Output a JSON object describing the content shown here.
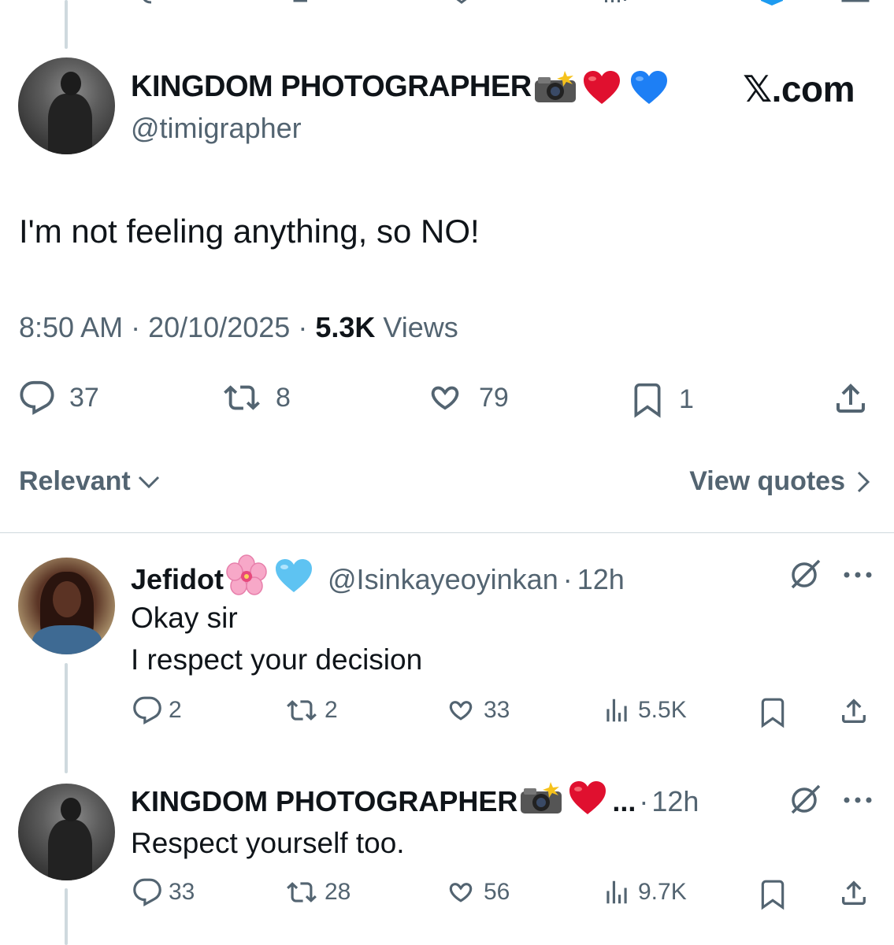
{
  "main_tweet": {
    "name": "KINGDOM PHOTOGRAPHER",
    "handle": "@timigrapher",
    "watermark": "𝕏.com",
    "text": "I'm not feeling anything, so NO!",
    "time": "8:50 AM",
    "date": "20/10/2025",
    "views_count": "5.3K",
    "views_label": "Views",
    "replies": "37",
    "reposts": "8",
    "likes": "79",
    "bookmarks": "1"
  },
  "sort": {
    "label": "Relevant",
    "view_quotes": "View quotes"
  },
  "replies": [
    {
      "name": "Jefidot",
      "handle": "@Isinkayeoyinkan",
      "time": "12h",
      "text_line1": "Okay sir",
      "text_line2": "I respect your decision",
      "replies": "2",
      "reposts": "2",
      "likes": "33",
      "views": "5.5K"
    },
    {
      "name": "KINGDOM PHOTOGRAPHER",
      "ellipsis": "...",
      "time": "12h",
      "text": "Respect yourself too.",
      "replies": "33",
      "reposts": "28",
      "likes": "56",
      "views": "9.7K"
    }
  ],
  "colors": {
    "text": "#0f1419",
    "secondary": "#536471",
    "divider": "#cfd9de",
    "heart_red": "#e0102f",
    "heart_blue": "#1d7ff5",
    "heart_light_blue": "#5ec3f2"
  }
}
